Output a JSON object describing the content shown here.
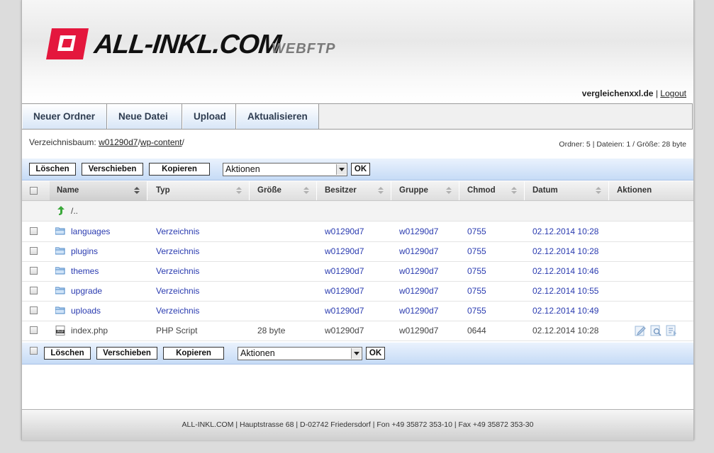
{
  "header": {
    "logo_text": "ALL-INKL.COM",
    "logo_sub": "WEBFTP",
    "username": "vergleichenxxl.de",
    "separator": "|",
    "logout_label": "Logout"
  },
  "toolbar": {
    "new_folder": "Neuer Ordner",
    "new_file": "Neue Datei",
    "upload": "Upload",
    "refresh": "Aktualisieren"
  },
  "path": {
    "label": "Verzeichnisbaum:",
    "segments": [
      "w01290d7",
      "wp-content"
    ],
    "sep": "/"
  },
  "stats": "Ordner: 5 | Dateien: 1 / Größe: 28 byte",
  "actions": {
    "delete": "Löschen",
    "move": "Verschieben",
    "copy": "Kopieren",
    "select_value": "Aktionen",
    "ok": "OK"
  },
  "columns": {
    "name": "Name",
    "type": "Typ",
    "size": "Größe",
    "owner": "Besitzer",
    "group": "Gruppe",
    "chmod": "Chmod",
    "date": "Datum",
    "actions": "Aktionen"
  },
  "parent_dir": "/..",
  "rows": [
    {
      "name": "languages",
      "type": "Verzeichnis",
      "size": "",
      "owner": "w01290d7",
      "group": "w01290d7",
      "chmod": "0755",
      "date": "02.12.2014 10:28"
    },
    {
      "name": "plugins",
      "type": "Verzeichnis",
      "size": "",
      "owner": "w01290d7",
      "group": "w01290d7",
      "chmod": "0755",
      "date": "02.12.2014 10:28"
    },
    {
      "name": "themes",
      "type": "Verzeichnis",
      "size": "",
      "owner": "w01290d7",
      "group": "w01290d7",
      "chmod": "0755",
      "date": "02.12.2014 10:46"
    },
    {
      "name": "upgrade",
      "type": "Verzeichnis",
      "size": "",
      "owner": "w01290d7",
      "group": "w01290d7",
      "chmod": "0755",
      "date": "02.12.2014 10:55"
    },
    {
      "name": "uploads",
      "type": "Verzeichnis",
      "size": "",
      "owner": "w01290d7",
      "group": "w01290d7",
      "chmod": "0755",
      "date": "02.12.2014 10:49"
    },
    {
      "name": "index.php",
      "type": "PHP Script",
      "size": "28 byte",
      "owner": "w01290d7",
      "group": "w01290d7",
      "chmod": "0644",
      "date": "02.12.2014 10:28"
    }
  ],
  "footer": "ALL-INKL.COM | Hauptstrasse 68 | D-02742 Friedersdorf | Fon +49 35872 353-10 | Fax +49 35872 353-30",
  "colors": {
    "brand_red": "#e4173d",
    "link_blue": "#2a3bb0",
    "toolbar_text": "#2e3c50",
    "action_bar": "#c6dbf6"
  },
  "icons": {
    "logo": "logo-mark-icon",
    "folder": "folder-icon",
    "php": "php-file-icon",
    "up": "up-arrow-icon",
    "edit": "edit-icon",
    "view": "view-icon",
    "properties": "properties-icon"
  }
}
